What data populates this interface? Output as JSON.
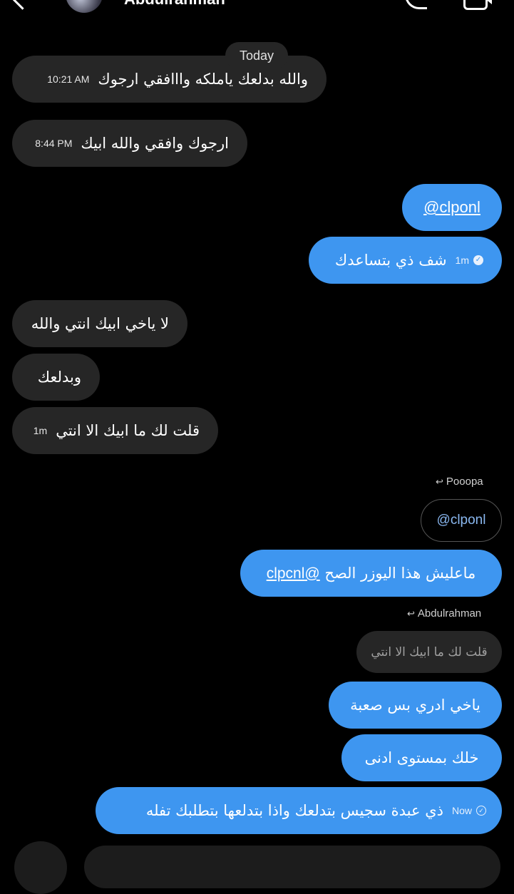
{
  "header": {
    "contact_name": "Abdulrahman",
    "back_icon": "chevron-left-icon",
    "call_icon": "phone-icon",
    "video_icon": "video-camera-icon"
  },
  "day_separator": "Today",
  "messages": [
    {
      "dir": "in",
      "text": "والله بدلعك ياملكه وااافقي ارجوك",
      "time": "10:21 AM"
    },
    {
      "dir": "in",
      "text": "ارجوك وافقي والله ابيك",
      "time": "8:44 PM"
    },
    {
      "dir": "out",
      "text": "@clponl"
    },
    {
      "dir": "out",
      "text": "شف ذي بتساعدك",
      "time": "1m"
    },
    {
      "dir": "in",
      "text": "لا ياخي ابيك انتي والله"
    },
    {
      "dir": "in",
      "text": "وبدلعك"
    },
    {
      "dir": "in",
      "text": "قلت لك ما ابيك الا انتي",
      "time": "1m"
    },
    {
      "dir": "out",
      "reply_to_name": "Pooopa",
      "reply_text": "@clponl",
      "text_before": "ماعليش هذا اليوزر الصح ",
      "text_link": "@clpcnl"
    },
    {
      "dir": "out",
      "reply_to_name": "Abdulrahman",
      "reply_text": "قلت لك ما ابيك الا انتي"
    },
    {
      "dir": "out",
      "text": "ياخي ادري بس صعبة"
    },
    {
      "dir": "out",
      "text": "خلك بمستوى ادنى"
    },
    {
      "dir": "out",
      "text": "ذي عبدة سجيس بتدلعك واذا بتدلعها بتطلبك تفله",
      "time": "Now"
    }
  ],
  "colors": {
    "background": "#000000",
    "incoming_bubble": "#262626",
    "outgoing_bubble": "#3e96f0"
  }
}
